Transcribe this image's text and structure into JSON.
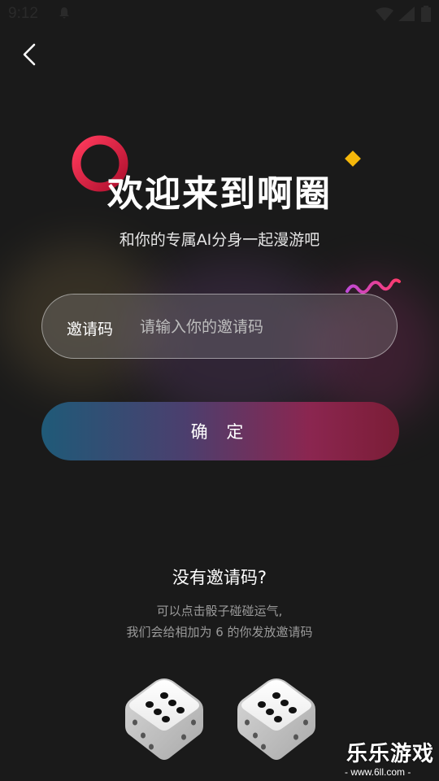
{
  "status_bar": {
    "time": "9:12"
  },
  "welcome": {
    "title": "欢迎来到啊圈",
    "subtitle": "和你的专属AI分身一起漫游吧"
  },
  "invite": {
    "label": "邀请码",
    "placeholder": "请输入你的邀请码",
    "value": ""
  },
  "confirm_label": "确 定",
  "no_code": {
    "title": "没有邀请码?",
    "hint_line1": "可以点击骰子碰碰运气,",
    "hint_line2": "我们会给相加为 6 的你发放邀请码"
  },
  "dice": [
    {
      "face": 6
    },
    {
      "face": 6
    }
  ],
  "watermark": {
    "title": "乐乐游戏",
    "url": "- www.6ll.com -"
  },
  "icons": {
    "back": "chevron-left-icon",
    "notification": "bell-icon",
    "wifi": "wifi-icon",
    "signal": "signal-icon",
    "battery": "battery-icon"
  },
  "colors": {
    "background": "#1a1a1a",
    "accent_ring": "#e0264a",
    "accent_diamond": "#f5b70a",
    "button_gradient_start": "#1f5a78",
    "button_gradient_end": "#7b1d36"
  }
}
